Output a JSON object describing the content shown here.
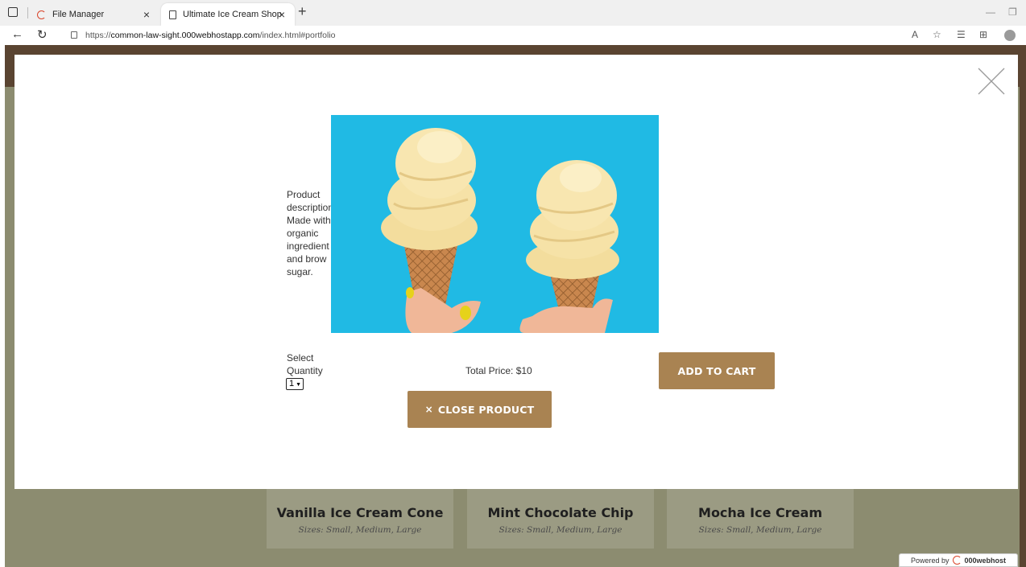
{
  "browser": {
    "tabs": [
      {
        "label": "File Manager",
        "active": false
      },
      {
        "label": "Ultimate Ice Cream Shop",
        "active": true
      }
    ],
    "tab_close_glyph": "×",
    "new_tab_glyph": "+",
    "url_prefix": "https://",
    "url_host": "common-law-sight.000webhostapp.com",
    "url_path": "/index.html#portfolio"
  },
  "modal": {
    "product_description": "Product description: Made with organic ingredient and brow sugar.",
    "quantity_label": "Select Quantity",
    "quantity_value": "1",
    "total_price": "Total Price: $10",
    "add_to_cart_label": "ADD TO CART",
    "close_product_label": "CLOSE PRODUCT",
    "close_glyph": "×"
  },
  "cards": [
    {
      "title": "Vanilla Ice Cream Cone",
      "subtitle": "Sizes: Small, Medium, Large"
    },
    {
      "title": "Mint Chocolate Chip",
      "subtitle": "Sizes: Small, Medium, Large"
    },
    {
      "title": "Mocha Ice Cream",
      "subtitle": "Sizes: Small, Medium, Large"
    }
  ],
  "footer": {
    "powered_by": "Powered by",
    "brand": "000webhost"
  },
  "colors": {
    "accent": "#a98352",
    "header": "#5a4431",
    "overlay": "#8c8c70",
    "image_bg": "#18b4e0"
  }
}
